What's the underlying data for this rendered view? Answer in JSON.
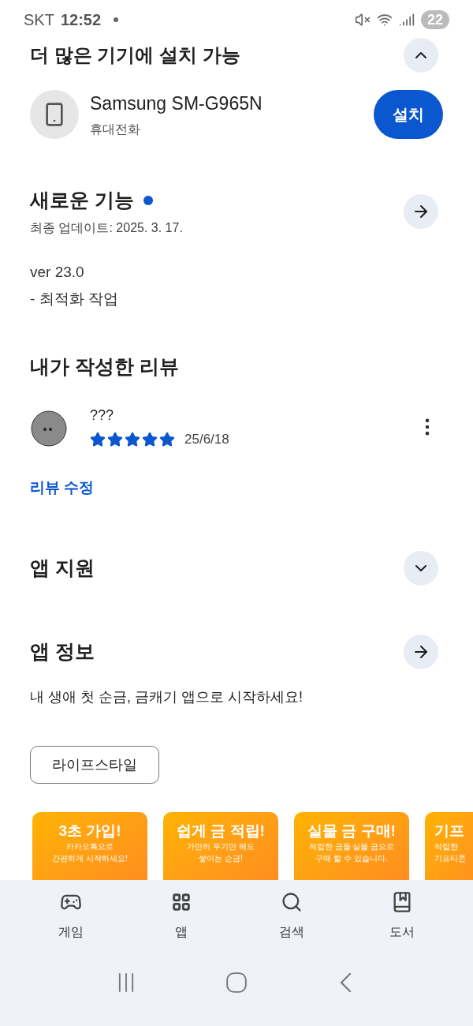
{
  "status_bar": {
    "carrier": "SKT",
    "time": "12:52",
    "battery": "22"
  },
  "install_section": {
    "title": "더 많은 기기에 설치 가능",
    "expanded": true,
    "device": {
      "name": "Samsung SM-G965N",
      "type": "휴대전화",
      "button": "설치"
    }
  },
  "whats_new": {
    "title": "새로운 기능",
    "unread": true,
    "updated": "최종 업데이트: 2025. 3. 17.",
    "lines": [
      "ver 23.0",
      "- 최적화 작업"
    ]
  },
  "my_review": {
    "title": "내가 작성한 리뷰",
    "author": "???",
    "stars": 5,
    "date": "25/6/18",
    "edit_link": "리뷰 수정"
  },
  "app_support": {
    "title": "앱 지원",
    "expanded": false
  },
  "app_info": {
    "title": "앱 정보",
    "description": "내 생애 첫 순금, 금캐기 앱으로 시작하세요!",
    "category": "라이프스타일"
  },
  "screenshots": [
    {
      "title": "3초 가입!",
      "lines": [
        "카카오톡으로",
        "간편하게 시작하세요!"
      ]
    },
    {
      "title": "쉽게 금 적립!",
      "lines": [
        "가만히 두기만 해도",
        "쌓이는 순금!"
      ]
    },
    {
      "title": "실물 금 구매!",
      "lines": [
        "적립한 금을 실물 금으로",
        "구매 할 수 있습니다."
      ]
    },
    {
      "title": "기프",
      "lines": [
        "적립한",
        "기프티콘"
      ]
    }
  ],
  "bottom_nav": [
    {
      "label": "게임",
      "kind": "games",
      "selected": false
    },
    {
      "label": "앱",
      "kind": "apps",
      "selected": false
    },
    {
      "label": "검색",
      "kind": "search",
      "selected": false
    },
    {
      "label": "도서",
      "kind": "books",
      "selected": false
    }
  ]
}
